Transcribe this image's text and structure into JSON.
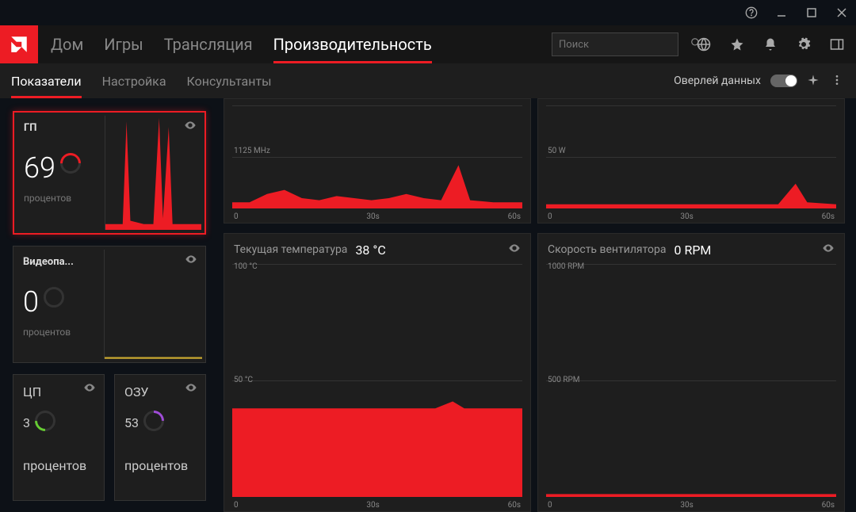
{
  "titlebar": {
    "help": "?"
  },
  "nav": {
    "tabs": [
      "Дом",
      "Игры",
      "Трансляция",
      "Производительность"
    ],
    "active": 3,
    "search_placeholder": "Поиск"
  },
  "subnav": {
    "tabs": [
      "Показатели",
      "Настройка",
      "Консультанты"
    ],
    "active": 0,
    "overlay_label": "Оверлей данных"
  },
  "cards": {
    "gpu": {
      "title": "ГП",
      "value": "69",
      "unit": "процентов"
    },
    "vram": {
      "title": "Видеопа...",
      "value": "0",
      "unit": "процентов"
    },
    "cpu": {
      "title": "ЦП",
      "value": "3",
      "unit": "процентов"
    },
    "ram": {
      "title": "ОЗУ",
      "value": "53",
      "unit": "процентов"
    }
  },
  "charts": {
    "clock": {
      "ylabel": "1125 MHz",
      "xticks": [
        "0",
        "30s",
        "60s"
      ]
    },
    "power": {
      "ylabel": "50 W",
      "xticks": [
        "0",
        "30s",
        "60s"
      ]
    },
    "temp": {
      "header_label": "Текущая температура",
      "header_value": "38 °C",
      "ylabels": [
        "100 °C",
        "50 °C"
      ],
      "xticks": [
        "0",
        "30s",
        "60s"
      ]
    },
    "fan": {
      "header_label": "Скорость вентилятора",
      "header_value": "0 RPM",
      "ylabels": [
        "1000 RPM",
        "500 RPM"
      ],
      "xticks": [
        "0",
        "30s",
        "60s"
      ]
    }
  },
  "chart_data": [
    {
      "id": "gpu-spark",
      "type": "area",
      "y": [
        5,
        5,
        95,
        8,
        5,
        5,
        98,
        10,
        90,
        5,
        5
      ],
      "ylim": [
        0,
        100
      ]
    },
    {
      "id": "clock",
      "type": "area",
      "y": [
        6,
        6,
        14,
        18,
        10,
        8,
        12,
        10,
        8,
        10,
        14,
        10,
        8,
        42,
        8,
        6,
        6
      ],
      "ylim": [
        0,
        100
      ],
      "ylabel": "1125 MHz",
      "xticks": [
        "0",
        "30s",
        "60s"
      ]
    },
    {
      "id": "power",
      "type": "area",
      "y": [
        4,
        4,
        4,
        4,
        4,
        4,
        4,
        4,
        4,
        4,
        4,
        4,
        4,
        4,
        24,
        6,
        4
      ],
      "ylim": [
        0,
        100
      ],
      "ylabel": "50 W",
      "xticks": [
        "0",
        "30s",
        "60s"
      ]
    },
    {
      "id": "temp",
      "type": "area",
      "y": [
        38,
        38,
        38,
        38,
        38,
        38,
        38,
        38,
        38,
        38,
        38,
        38,
        40,
        38,
        38,
        38,
        38
      ],
      "ylim": [
        0,
        100
      ],
      "title": "Текущая температура 38 °C",
      "ylabel": "°C",
      "xticks": [
        "0",
        "30s",
        "60s"
      ]
    },
    {
      "id": "fan",
      "type": "area",
      "y": [
        0,
        0,
        0,
        0,
        0,
        0,
        0,
        0,
        0,
        0,
        0,
        0,
        0,
        0,
        0,
        0,
        0
      ],
      "ylim": [
        0,
        1000
      ],
      "title": "Скорость вентилятора 0 RPM",
      "ylabel": "RPM",
      "xticks": [
        "0",
        "30s",
        "60s"
      ]
    }
  ]
}
